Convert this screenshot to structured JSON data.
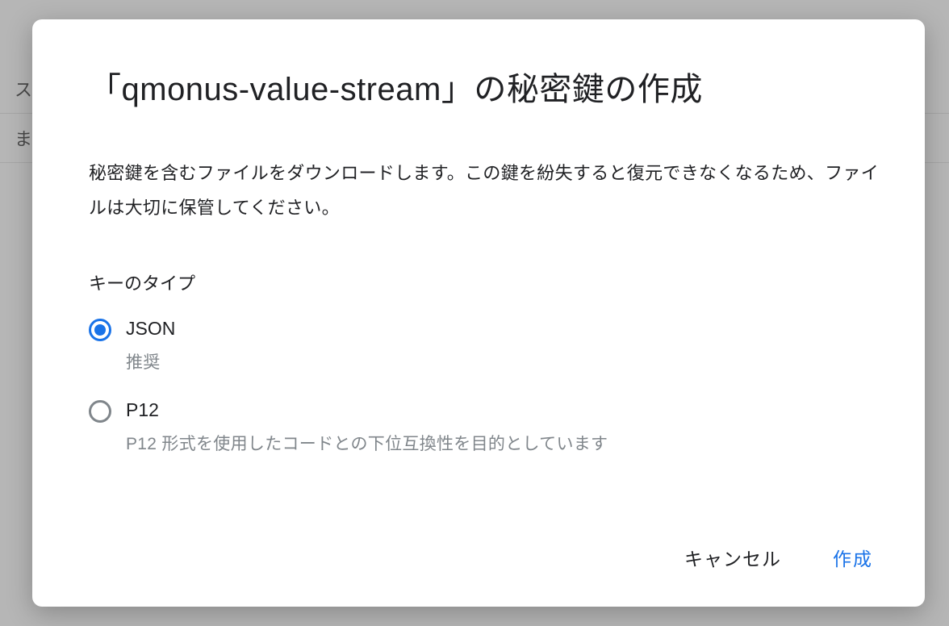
{
  "background": {
    "text1": "ス",
    "text2": "ま"
  },
  "dialog": {
    "title": "「qmonus-value-stream」の秘密鍵の作成",
    "description": "秘密鍵を含むファイルをダウンロードします。この鍵を紛失すると復元できなくなるため、ファイルは大切に保管してください。",
    "sectionLabel": "キーのタイプ",
    "options": [
      {
        "label": "JSON",
        "sublabel": "推奨",
        "selected": true
      },
      {
        "label": "P12",
        "sublabel": "P12 形式を使用したコードとの下位互換性を目的としています",
        "selected": false
      }
    ],
    "actions": {
      "cancel": "キャンセル",
      "create": "作成"
    }
  }
}
